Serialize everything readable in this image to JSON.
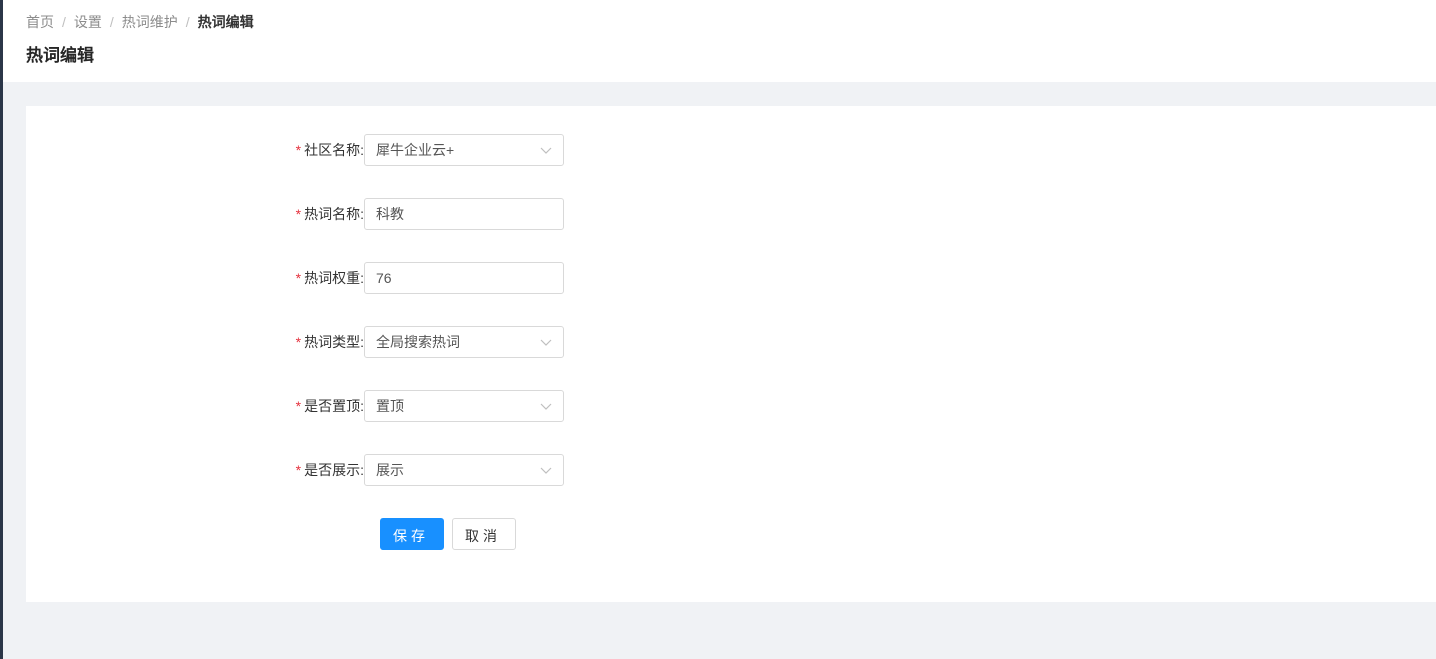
{
  "breadcrumb": {
    "items": [
      "首页",
      "设置",
      "热词维护"
    ],
    "current": "热词编辑",
    "separator": "/"
  },
  "page_title": "热词编辑",
  "form": {
    "required_mark": "*",
    "community": {
      "label": "社区名称:",
      "value": "犀牛企业云+"
    },
    "hotword_name": {
      "label": "热词名称:",
      "value": "科教"
    },
    "hotword_weight": {
      "label": "热词权重:",
      "value": "76"
    },
    "hotword_type": {
      "label": "热词类型:",
      "value": "全局搜索热词"
    },
    "pinned": {
      "label": "是否置顶:",
      "value": "置顶"
    },
    "displayed": {
      "label": "是否展示:",
      "value": "展示"
    }
  },
  "actions": {
    "save_label": "保存",
    "cancel_label": "取消"
  },
  "colors": {
    "primary": "#1890ff",
    "required": "#e5323e",
    "background": "#f0f2f5"
  },
  "icons": {
    "select_arrow": "chevron-down-icon"
  }
}
